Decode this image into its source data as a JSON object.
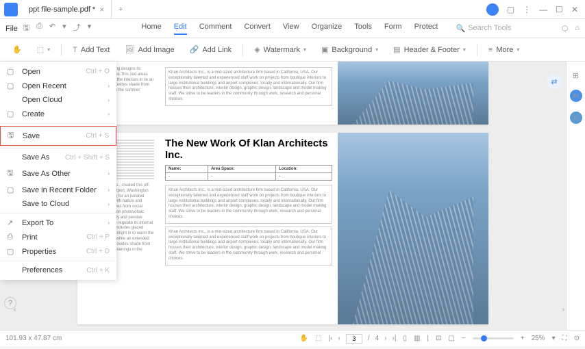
{
  "titlebar": {
    "filename": "ppt file-sample.pdf *"
  },
  "menubar": {
    "file": "File",
    "tabs": [
      "Home",
      "Edit",
      "Comment",
      "Convert",
      "View",
      "Organize",
      "Tools",
      "Form",
      "Protect"
    ],
    "active_tab": "Edit",
    "search_placeholder": "Search Tools"
  },
  "toolbar": {
    "add_text": "Add Text",
    "add_image": "Add Image",
    "add_link": "Add Link",
    "watermark": "Watermark",
    "background": "Background",
    "header_footer": "Header & Footer",
    "more": "More"
  },
  "file_menu": {
    "items": [
      {
        "icon": "▢",
        "label": "Open",
        "shortcut": "Ctrl + O",
        "sub": false
      },
      {
        "icon": "▢",
        "label": "Open Recent",
        "shortcut": "",
        "sub": true
      },
      {
        "icon": "",
        "label": "Open Cloud",
        "shortcut": "",
        "sub": true
      },
      {
        "icon": "▢",
        "label": "Create",
        "shortcut": "",
        "sub": true
      },
      {
        "sep": true
      },
      {
        "icon": "🖫",
        "label": "Save",
        "shortcut": "Ctrl + S",
        "sub": false,
        "highlight": true
      },
      {
        "sep": true
      },
      {
        "icon": "",
        "label": "Save As",
        "shortcut": "Ctrl + Shift + S",
        "sub": false
      },
      {
        "icon": "🖫",
        "label": "Save As Other",
        "shortcut": "",
        "sub": true
      },
      {
        "icon": "▢",
        "label": "Save in Recent Folder",
        "shortcut": "",
        "sub": true
      },
      {
        "icon": "",
        "label": "Save to Cloud",
        "shortcut": "",
        "sub": true
      },
      {
        "sep": true
      },
      {
        "icon": "↗",
        "label": "Export To",
        "shortcut": "",
        "sub": true
      },
      {
        "icon": "⎙",
        "label": "Print",
        "shortcut": "Ctrl + P",
        "sub": false
      },
      {
        "icon": "▢",
        "label": "Properties",
        "shortcut": "Ctrl + D",
        "sub": false
      },
      {
        "sep": true
      },
      {
        "icon": "",
        "label": "Preferences",
        "shortcut": "Ctrl + K",
        "sub": false
      }
    ]
  },
  "document": {
    "page2_title": "The New Work Of Klan Architects Inc.",
    "table_headers": [
      "Name:",
      "Area Space:",
      "Location:"
    ],
    "para": "Khan Architects Inc., is a mid-sized architecture firm based in California, USA. Our exceptionally talented and experienced staff work on projects from boutique interiors to large institutional buildings and airport complexes, locally and internationally. Our firm houses their architecture, interior design, graphic design, landscape and model making staff. We strive to be leaders in the community through work, research and personal choices.",
    "left_text": "and passive building designs its internal temperature.This zed areas that bring to warm the interiors in ile an extended west- provides shade from solar g evenings in the summer",
    "left_text2": "Khan Architects Inc., created this off-grid retreat in Westport, Washington for a family looking for an isolated place to connect with nature and \"distance themselves from social stresses\". It relies on photovoltaic panels for electricity and passive building designs to regulate its internal temperature.This includes glazed areas that bring sunlight in to warm the interiors in winter, while an extended west-facing roof provides shade from solar heat during evenings in the summer"
  },
  "statusbar": {
    "dimensions": "101.93 x 47.87 cm",
    "page_current": "3",
    "page_total": "4",
    "zoom": "25%"
  }
}
